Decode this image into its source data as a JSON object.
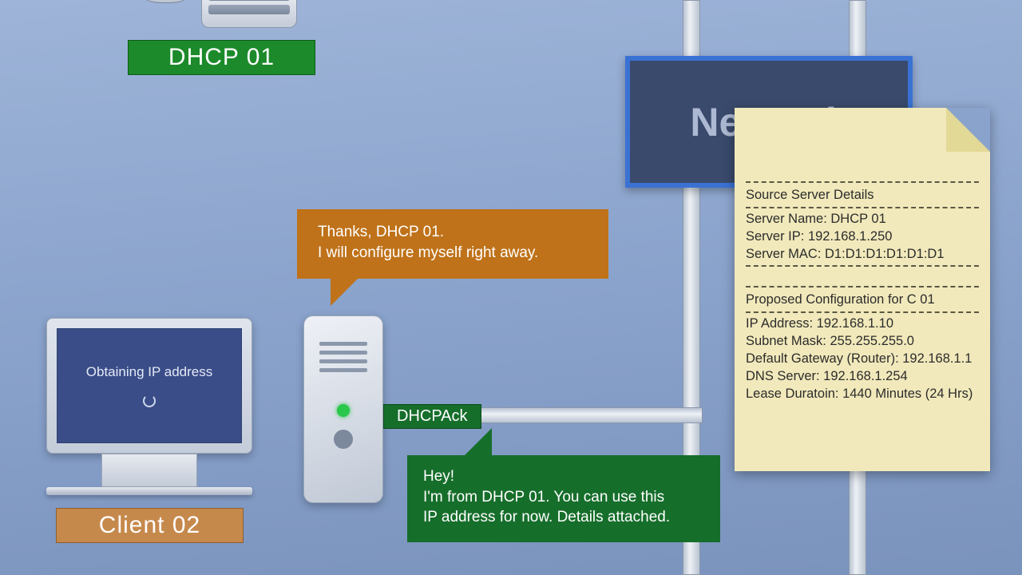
{
  "dhcp_label": "DHCP 01",
  "network_label": "Network",
  "client": {
    "screen_text": "Obtaining IP address",
    "label": "Client 02"
  },
  "bubble_orange": {
    "line1": "Thanks, DHCP 01.",
    "line2": "I will configure myself right away."
  },
  "bubble_green": {
    "line1": "Hey!",
    "line2": "I'm from DHCP 01. You can use this",
    "line3": "IP address for now. Details attached."
  },
  "ack_tag": "DHCPAck",
  "note": {
    "src_title": "Source Server Details",
    "src_name": "Server Name: DHCP 01",
    "src_ip": "Server IP: 192.168.1.250",
    "src_mac": "Server MAC: D1:D1:D1:D1:D1:D1",
    "cfg_title": "Proposed Configuration for C 01",
    "cfg_ip": "IP Address: 192.168.1.10",
    "cfg_mask": "Subnet Mask: 255.255.255.0",
    "cfg_gw": "Default Gateway (Router): 192.168.1.1",
    "cfg_dns": "DNS Server: 192.168.1.254",
    "cfg_lease": "Lease Duratoin: 1440 Minutes (24 Hrs)"
  }
}
